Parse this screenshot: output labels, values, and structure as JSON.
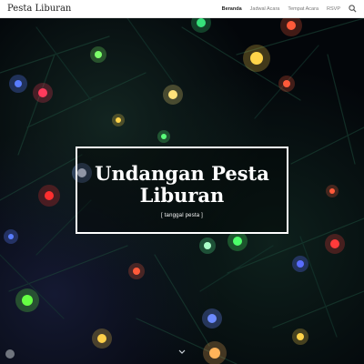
{
  "header": {
    "site_title": "Pesta Liburan",
    "nav": [
      {
        "label": "Beranda",
        "active": true
      },
      {
        "label": "Jadwal Acara",
        "active": false
      },
      {
        "label": "Tempat Acara",
        "active": false
      },
      {
        "label": "RSVP",
        "active": false
      }
    ],
    "search_icon": "search-icon"
  },
  "hero": {
    "title": "Undangan Pesta Liburan",
    "subtitle": "[ tanggal pesta ]",
    "scroll_icon": "chevron-down-icon"
  }
}
